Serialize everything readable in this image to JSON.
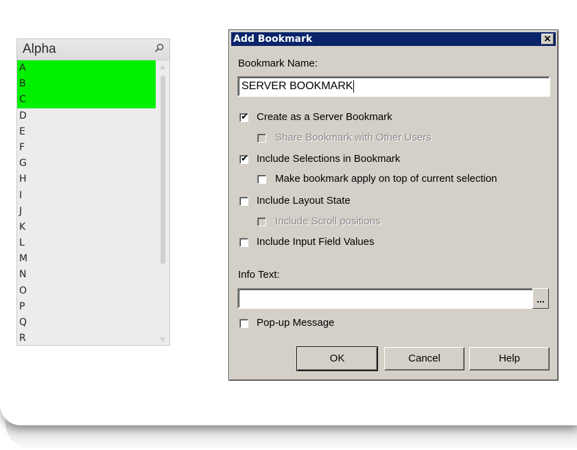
{
  "listbox": {
    "title": "Alpha",
    "items": [
      {
        "label": "A",
        "selected": true
      },
      {
        "label": "B",
        "selected": true
      },
      {
        "label": "C",
        "selected": true
      },
      {
        "label": "D",
        "selected": false
      },
      {
        "label": "E",
        "selected": false
      },
      {
        "label": "F",
        "selected": false
      },
      {
        "label": "G",
        "selected": false
      },
      {
        "label": "H",
        "selected": false
      },
      {
        "label": "I",
        "selected": false
      },
      {
        "label": "J",
        "selected": false
      },
      {
        "label": "K",
        "selected": false
      },
      {
        "label": "L",
        "selected": false
      },
      {
        "label": "M",
        "selected": false
      },
      {
        "label": "N",
        "selected": false
      },
      {
        "label": "O",
        "selected": false
      },
      {
        "label": "P",
        "selected": false
      },
      {
        "label": "Q",
        "selected": false
      },
      {
        "label": "R",
        "selected": false
      }
    ],
    "selected_color": "#00f000"
  },
  "dialog": {
    "title": "Add Bookmark",
    "close_label": "✕",
    "name_label": "Bookmark Name:",
    "name_value": "SERVER BOOKMARK",
    "options": {
      "server_bookmark": {
        "label": "Create as a Server Bookmark",
        "checked": true,
        "enabled": true
      },
      "share_bookmark": {
        "label": "Share Bookmark with Other Users",
        "checked": false,
        "enabled": false
      },
      "include_selections": {
        "label": "Include Selections in Bookmark",
        "checked": true,
        "enabled": true
      },
      "apply_on_top": {
        "label": "Make bookmark apply on top of current selection",
        "checked": false,
        "enabled": true
      },
      "include_layout": {
        "label": "Include Layout State",
        "checked": false,
        "enabled": true
      },
      "include_scroll": {
        "label": "Include Scroll positions",
        "checked": false,
        "enabled": false
      },
      "include_input": {
        "label": "Include Input Field Values",
        "checked": false,
        "enabled": true
      },
      "popup_message": {
        "label": "Pop-up Message",
        "checked": false,
        "enabled": true
      }
    },
    "info_label": "Info Text:",
    "info_value": "",
    "ellipsis_label": "...",
    "buttons": {
      "ok": "OK",
      "cancel": "Cancel",
      "help": "Help"
    },
    "check_mark": "✔",
    "titlebar_color": "#0a246a",
    "face_color": "#d4d0c8"
  }
}
